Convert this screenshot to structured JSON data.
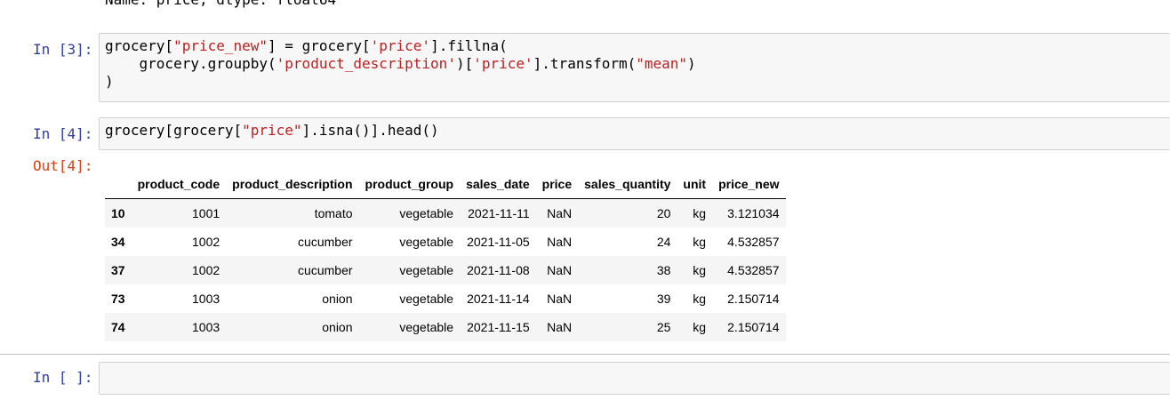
{
  "previous_output": "Name: price, dtype: float64",
  "cells": [
    {
      "prompt": "In [3]:",
      "code": [
        [
          {
            "t": "grocery["
          },
          {
            "t": "\"price_new\"",
            "s": true
          },
          {
            "t": "] = grocery["
          },
          {
            "t": "'price'",
            "s": true
          },
          {
            "t": "].fillna("
          }
        ],
        [
          {
            "t": "    grocery.groupby("
          },
          {
            "t": "'product_description'",
            "s": true
          },
          {
            "t": ")["
          },
          {
            "t": "'price'",
            "s": true
          },
          {
            "t": "].transform("
          },
          {
            "t": "\"mean\"",
            "s": true
          },
          {
            "t": ")"
          }
        ],
        [
          {
            "t": ")"
          }
        ]
      ]
    },
    {
      "prompt": "In [4]:",
      "code": [
        [
          {
            "t": "grocery[grocery["
          },
          {
            "t": "\"price\"",
            "s": true
          },
          {
            "t": "].isna()].head()"
          }
        ]
      ]
    },
    {
      "prompt": "In [ ]:",
      "code": []
    }
  ],
  "output_prompt": "Out[4]:",
  "dataframe": {
    "columns": [
      "",
      "product_code",
      "product_description",
      "product_group",
      "sales_date",
      "price",
      "sales_quantity",
      "unit",
      "price_new"
    ],
    "rows": [
      [
        "10",
        "1001",
        "tomato",
        "vegetable",
        "2021-11-11",
        "NaN",
        "20",
        "kg",
        "3.121034"
      ],
      [
        "34",
        "1002",
        "cucumber",
        "vegetable",
        "2021-11-05",
        "NaN",
        "24",
        "kg",
        "4.532857"
      ],
      [
        "37",
        "1002",
        "cucumber",
        "vegetable",
        "2021-11-08",
        "NaN",
        "38",
        "kg",
        "4.532857"
      ],
      [
        "73",
        "1003",
        "onion",
        "vegetable",
        "2021-11-14",
        "NaN",
        "39",
        "kg",
        "2.150714"
      ],
      [
        "74",
        "1003",
        "onion",
        "vegetable",
        "2021-11-15",
        "NaN",
        "25",
        "kg",
        "2.150714"
      ]
    ]
  },
  "colors": {
    "input_prompt": "#303f9f",
    "output_prompt": "#d84315",
    "string_literal": "#ba2121",
    "cell_background": "#f7f7f7"
  }
}
